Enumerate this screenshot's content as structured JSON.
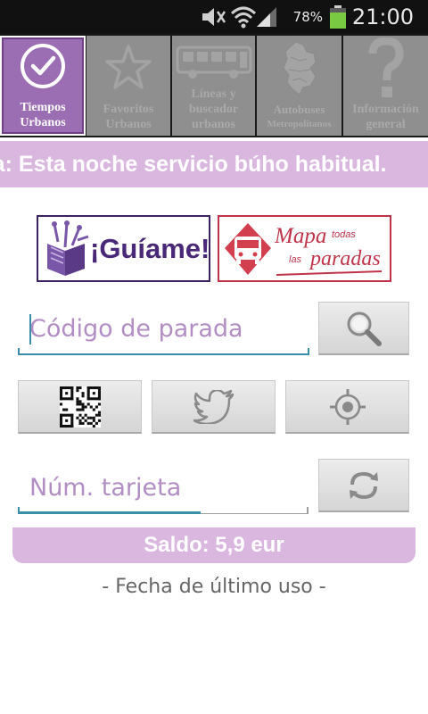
{
  "status_bar": {
    "battery_text": "78%",
    "battery_level": 0.78,
    "time": "21:00",
    "icons": [
      "mute-icon",
      "wifi-icon",
      "signal-icon",
      "battery-icon"
    ]
  },
  "tabs": [
    {
      "label_line1": "Tiempos",
      "label_line2": "Urbanos",
      "icon": "checkmark-circle-icon",
      "active": true
    },
    {
      "label_line1": "Favoritos",
      "label_line2": "Urbanos",
      "icon": "star-icon",
      "active": false
    },
    {
      "label_line1": "Líneas y",
      "label_line2": "buscador",
      "label_line3": "urbanos",
      "icon": "bus-icon",
      "active": false
    },
    {
      "label_line1": "Autobuses",
      "label_line2": "Metropolitanos",
      "icon": "province-map-icon",
      "active": false
    },
    {
      "label_line1": "Información",
      "label_line2": "general",
      "icon": "question-icon",
      "active": false
    }
  ],
  "ticker": {
    "text": "ra: Esta noche servicio búho habitual."
  },
  "banners": {
    "guiame_label": "¡Guíame!",
    "mapa_big": "Mapa",
    "mapa_small1": "todas",
    "mapa_small2": "las",
    "mapa_big2": "paradas"
  },
  "stop_search": {
    "placeholder": "Código de parada",
    "value": ""
  },
  "card": {
    "placeholder": "Núm. tarjeta",
    "value": "",
    "progress": 0.63
  },
  "saldo": {
    "text": "Saldo:  5,9 eur"
  },
  "last_use": {
    "text": "- Fecha de último uso -"
  },
  "colors": {
    "accent": "#9b6db2",
    "ticker_bg": "#d9b7df",
    "tab_inactive": "#8f8f8f",
    "field_line": "#3a8fa8"
  }
}
